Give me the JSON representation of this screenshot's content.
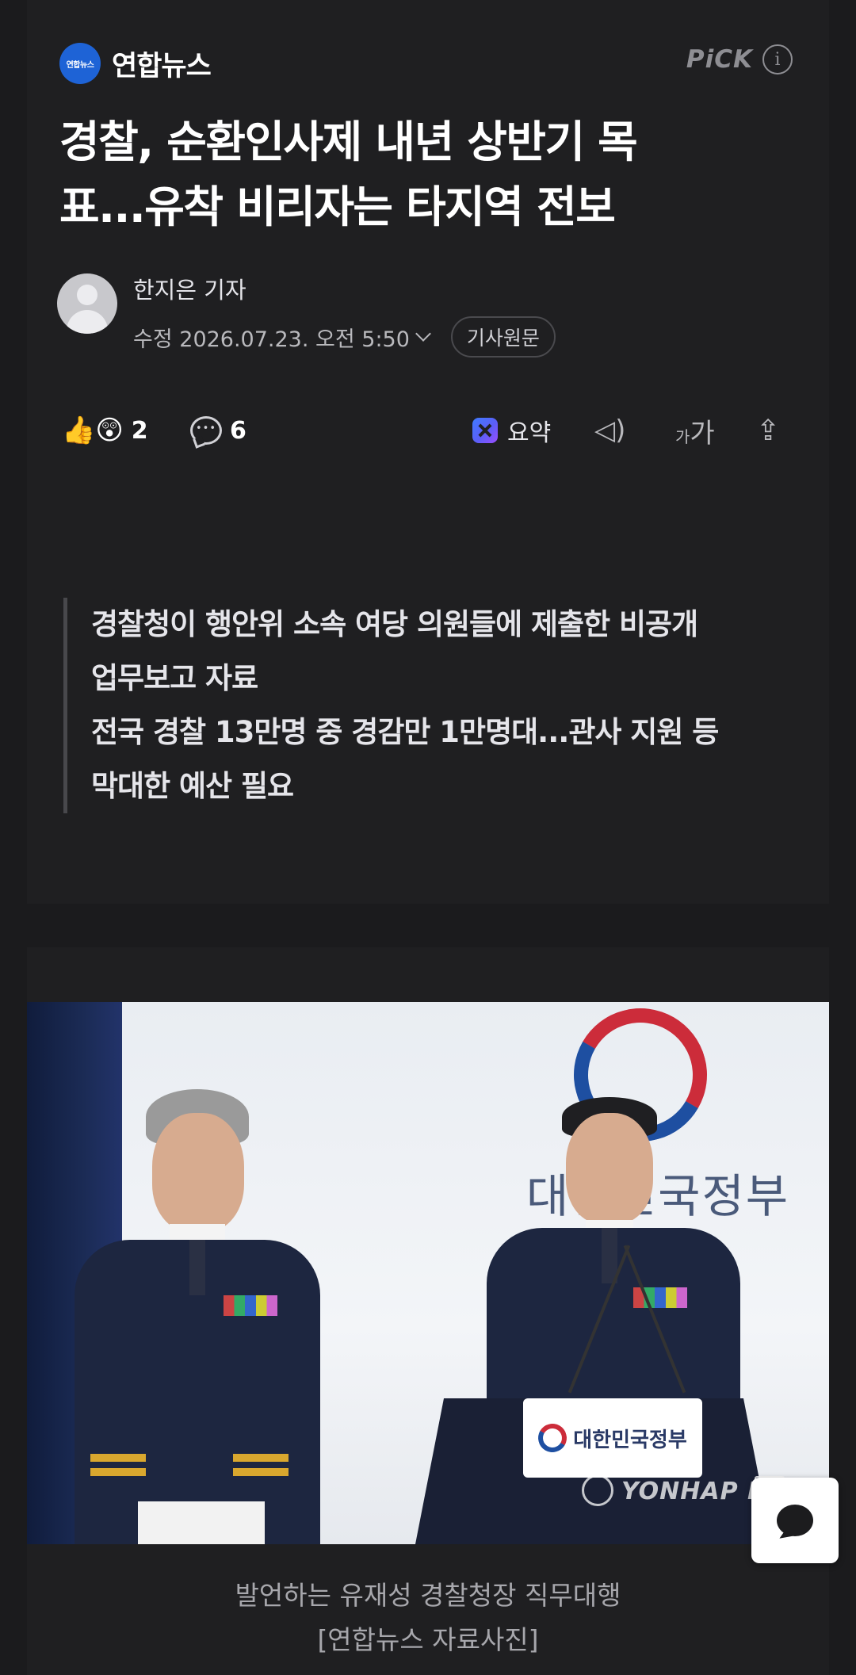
{
  "publisher": {
    "name": "연합뉴스",
    "logo_text": "연합뉴스"
  },
  "pick": {
    "label": "PiCK",
    "info_icon": "i"
  },
  "article": {
    "headline_line1": "경찰, 순환인사제 내년 상반기 목",
    "headline_line2": "표...유착 비리자는 타지역 전보",
    "reporter": "한지은 기자",
    "date": "수정 2026.07.23. 오전 5:50",
    "original_button": "기사원문"
  },
  "actions": {
    "reactions_icon": "👍😲",
    "reactions_count": "2",
    "comments_count": "6",
    "summary_label": "요약",
    "speaker_icon": "speaker-icon",
    "font_small": "가",
    "font_large": "가",
    "share_icon": "share-icon"
  },
  "summary": {
    "line1": "경찰청이 행안위 소속 여당 의원들에 제출한 비공개",
    "line2": "업무보고 자료",
    "line3": "전국 경찰 13만명 중 경감만 1만명대...관사 지원 등",
    "line4": "막대한 예산 필요"
  },
  "photo": {
    "backdrop_text": "대한민국정부",
    "podium_text": "대한민국정부",
    "watermark": "YONHAP N",
    "caption_line1": "발언하는 유재성 경찰청장 직무대행",
    "caption_line2": "[연합뉴스 자료사진]"
  },
  "colors": {
    "background": "#1b1b1d",
    "card": "#1f1f21",
    "accent_logo": "#1e63d6"
  }
}
